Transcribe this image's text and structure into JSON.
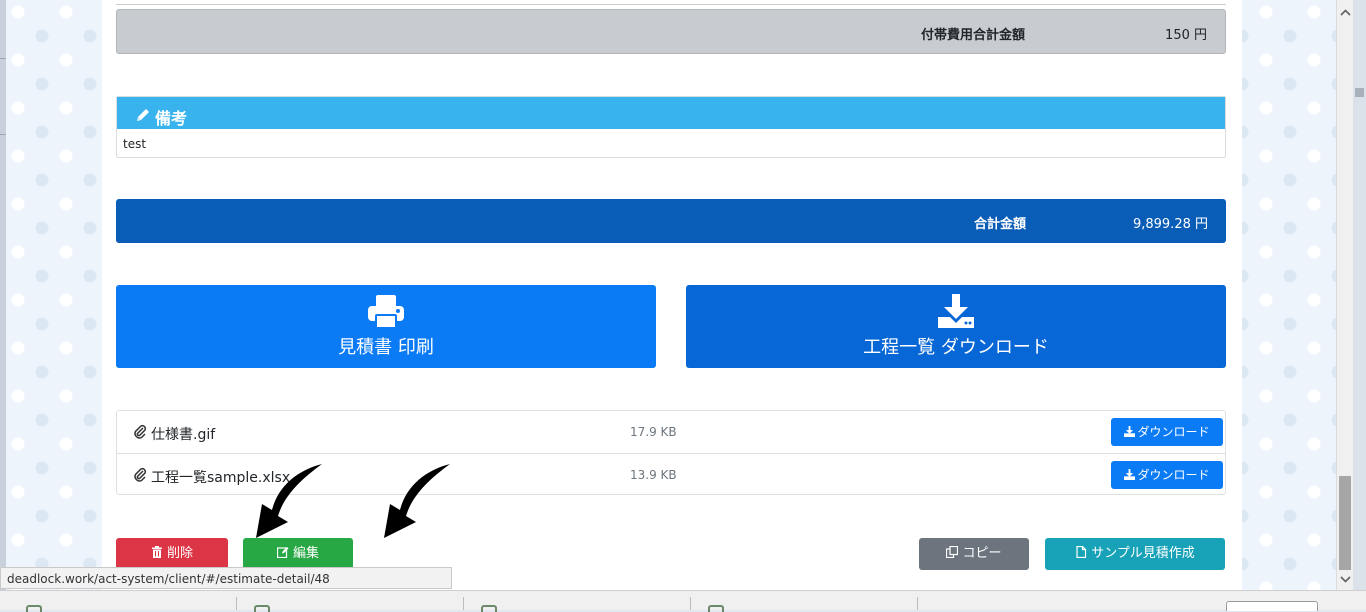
{
  "summary": {
    "additional_cost_label": "付帯費用合計金額",
    "additional_cost_value": "150 円"
  },
  "remarks": {
    "title": "備考",
    "body": "test",
    "icon": "pencil-icon"
  },
  "grand_total": {
    "label": "合計金額",
    "value": "9,899.28 円"
  },
  "actions_top": {
    "print_label": "見積書 印刷",
    "print_icon": "printer-icon",
    "process_download_label": "工程一覧 ダウンロード",
    "process_download_icon": "download-icon"
  },
  "files": [
    {
      "name": "仕様書.gif",
      "size": "17.9 KB",
      "button": "ダウンロード"
    },
    {
      "name": "工程一覧sample.xlsx",
      "size": "13.9 KB",
      "button": "ダウンロード"
    }
  ],
  "bottom_actions": {
    "delete": "削除",
    "edit": "編集",
    "copy": "コピー",
    "sample": "サンプル見積作成"
  },
  "status_bar": {
    "url": "deadlock.work/act-system/client/#/estimate-detail/48"
  },
  "colors": {
    "primary": "#0b7bf5",
    "dark_primary": "#0a5db7",
    "remarks_header": "#39b3ed",
    "danger": "#dc3545",
    "success": "#28a745",
    "secondary": "#6c757d",
    "info": "#17a2b8"
  }
}
